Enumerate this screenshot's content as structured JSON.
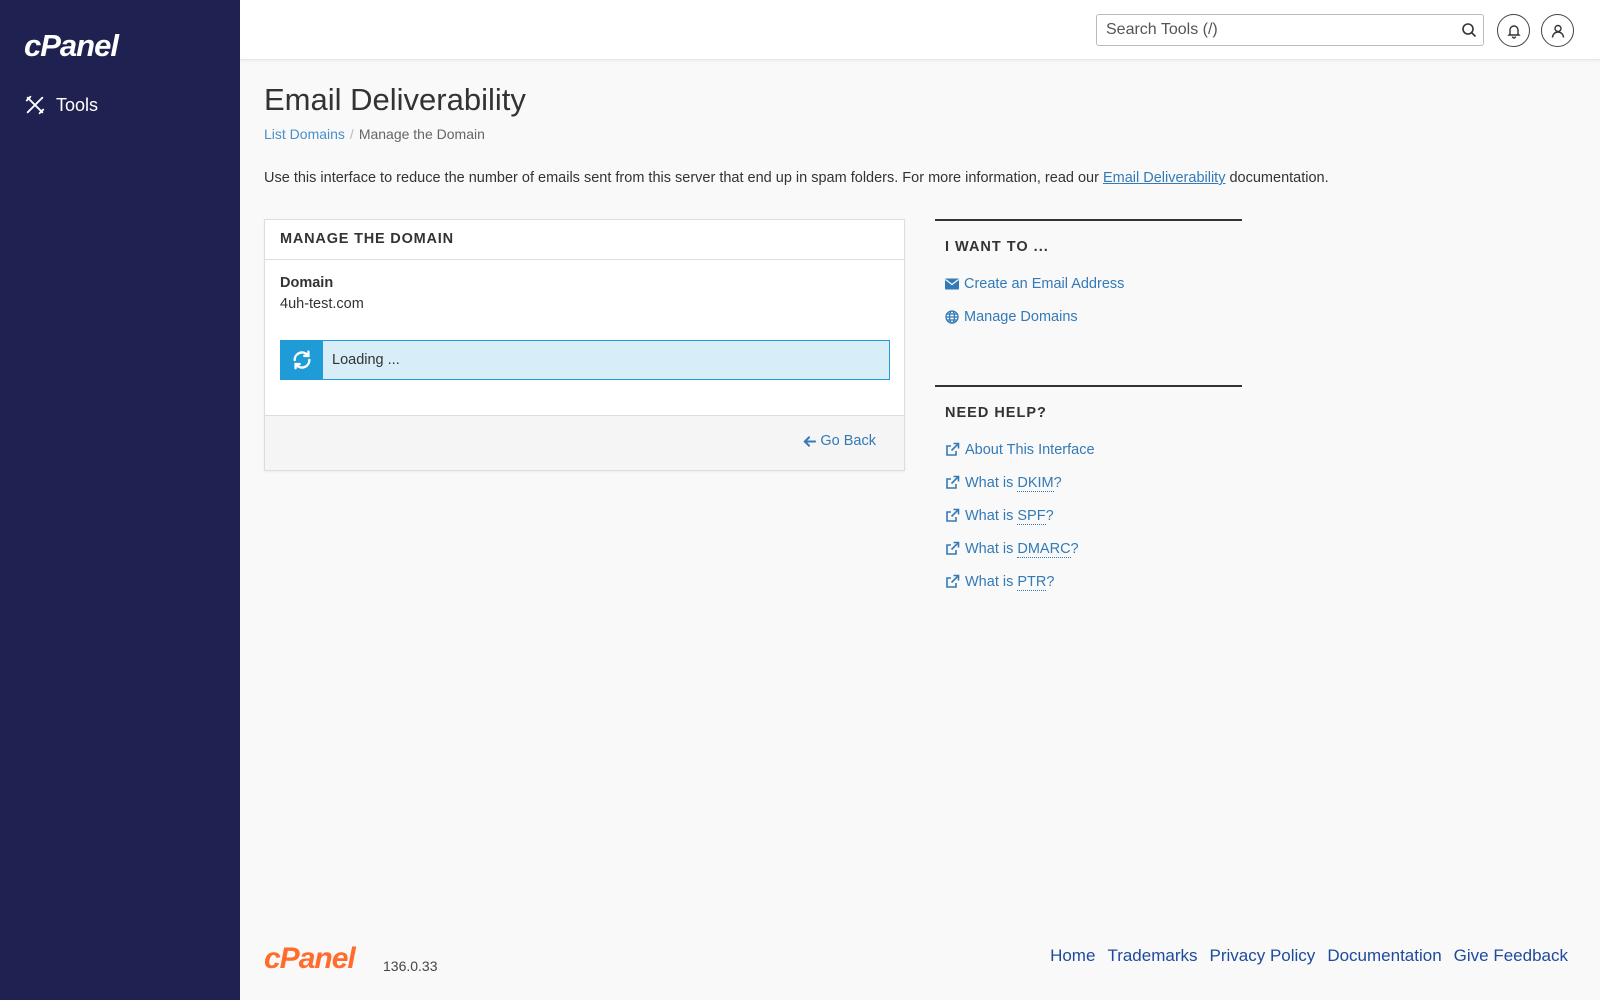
{
  "sidebar": {
    "logo": "cPanel",
    "items": [
      {
        "label": "Tools",
        "icon": "tools-icon"
      }
    ]
  },
  "topbar": {
    "search_placeholder": "Search Tools (/)",
    "search_icon": "search-icon",
    "notifications_icon": "bell-icon",
    "user_icon": "user-icon"
  },
  "page": {
    "title": "Email Deliverability",
    "breadcrumb": {
      "link": "List Domains",
      "separator": "/",
      "current": "Manage the Domain"
    },
    "description_before": "Use this interface to reduce the number of emails sent from this server that end up in spam folders. For more information, read our ",
    "description_link": "Email Deliverability",
    "description_after": " documentation."
  },
  "panel": {
    "heading": "MANAGE THE DOMAIN",
    "domain_label": "Domain",
    "domain_value": "4uh-test.com",
    "loading_text": "Loading ...",
    "go_back": "Go Back"
  },
  "i_want_to": {
    "heading": "I WANT TO ...",
    "links": [
      {
        "label": "Create an Email Address",
        "icon": "envelope-icon"
      },
      {
        "label": "Manage Domains",
        "icon": "globe-icon"
      }
    ]
  },
  "need_help": {
    "heading": "NEED HELP?",
    "about": "About This Interface",
    "what_is": "What is ",
    "dkim": "DKIM",
    "spf": "SPF",
    "dmarc": "DMARC",
    "ptr": "PTR",
    "q": "?"
  },
  "footer": {
    "logo": "cPanel",
    "version": "136.0.33",
    "links": [
      "Home",
      "Trademarks",
      "Privacy Policy",
      "Documentation",
      "Give Feedback"
    ]
  },
  "colors": {
    "sidebar_bg": "#1f2251",
    "link": "#337ab7",
    "loading_accent": "#1f9bd7",
    "loading_bg": "#d7edf8",
    "footer_logo": "#ff6c2c"
  }
}
